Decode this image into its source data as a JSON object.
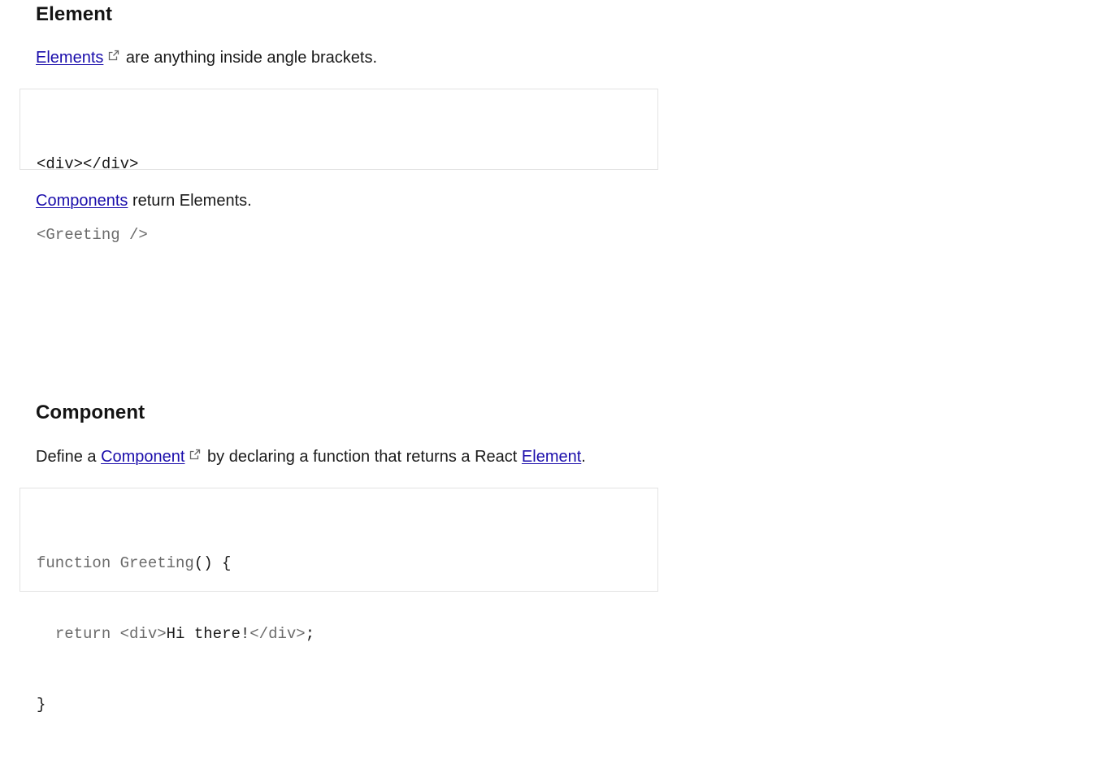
{
  "element_section": {
    "heading": "Element",
    "intro": {
      "link_text": "Elements",
      "text_after": " are anything inside angle brackets."
    },
    "code_lines": [
      [
        "<div></div>"
      ],
      [
        "<Greeting />"
      ]
    ],
    "outro": {
      "link_text": "Components",
      "text_after": " return Elements."
    }
  },
  "component_section": {
    "heading": "Component",
    "intro": {
      "text_before": "Define a ",
      "link_text": "Component",
      "text_middle": " by declaring a function that returns a React ",
      "link2_text": "Element",
      "text_after": "."
    },
    "code": {
      "line1_keyword": "function",
      "line1_name": " Greeting",
      "line1_rest": "() {",
      "line2_indent": "  ",
      "line2_keyword": "return",
      "line2_rest_muted1": " <div>",
      "line2_text": "Hi there!",
      "line2_rest_muted2": "</div>",
      "line2_end": ";",
      "line3": "}"
    }
  },
  "colors": {
    "link": "#1a0dab",
    "text": "#1a1a1a",
    "code_muted": "#6b6b6b",
    "code_border": "#e3e3e3"
  },
  "icons": {
    "external_link": "external-link-icon"
  }
}
